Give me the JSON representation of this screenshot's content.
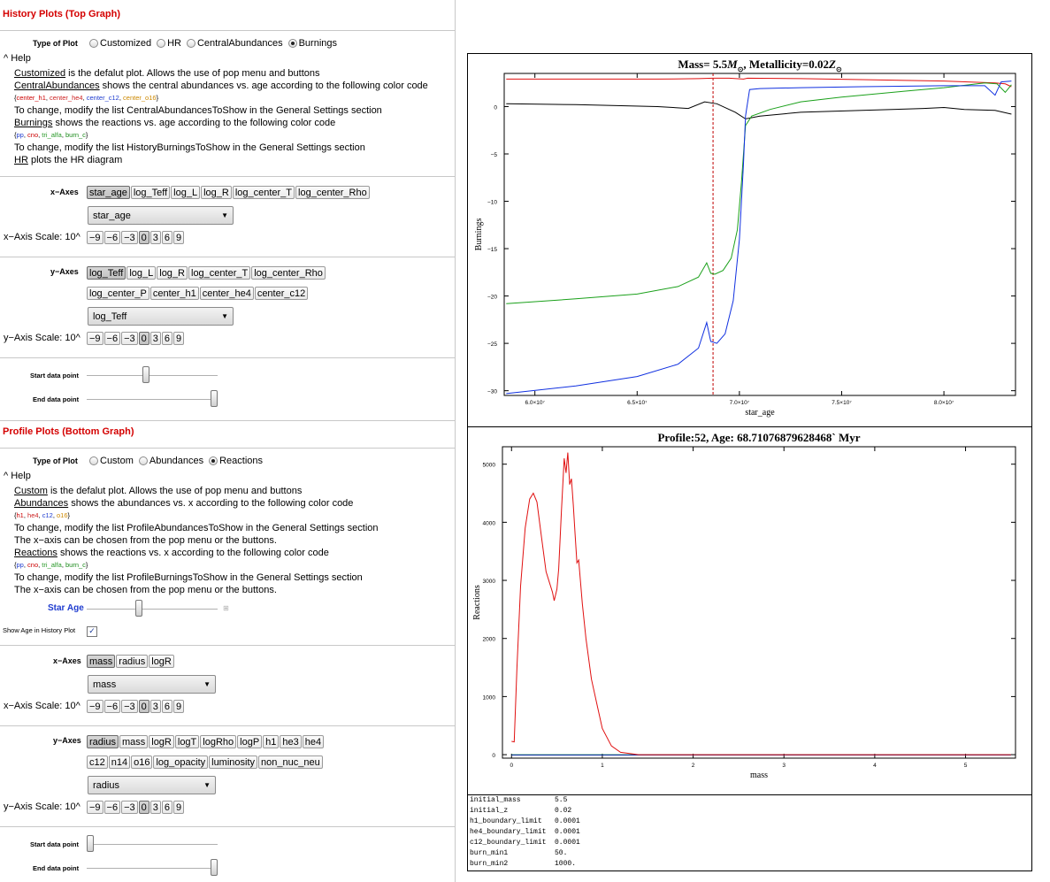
{
  "history": {
    "title": "History Plots (Top Graph)",
    "type_label": "Type of Plot",
    "type_options": [
      "Customized",
      "HR",
      "CentralAbundances",
      "Burnings"
    ],
    "type_selected_index": 3,
    "help_label": "Help",
    "help_lines": [
      {
        "u": "Customized",
        "rest": " is the defalut plot. Allows the use of pop menu and  buttons"
      },
      {
        "u": "CentralAbundances",
        "rest": " shows the central abundances vs. age according to the following color code"
      },
      {
        "u": "",
        "rest": "",
        "codes": [
          "center_h1",
          "center_he4",
          "center_c12",
          "center_o16"
        ]
      },
      {
        "u": "",
        "rest": "To change, modify the list CentralAbundancesToShow in the General Settings section"
      },
      {
        "u": "Burnings",
        "rest": " shows the reactions vs. age according to the following color code"
      },
      {
        "u": "",
        "rest": "",
        "codes": [
          "pp",
          "cno",
          "tri_alfa",
          "burn_c"
        ]
      },
      {
        "u": "",
        "rest": "To change, modify the list HistoryBurningsToShow in the General Settings section"
      },
      {
        "u": "HR",
        "rest": " plots the HR diagram"
      }
    ],
    "xaxes_label": "x−Axes",
    "xaxes_buttons": [
      "star_age",
      "log_Teff",
      "log_L",
      "log_R",
      "log_center_T",
      "log_center_Rho"
    ],
    "xaxes_selected": "star_age",
    "xscale_label": "x−Axis Scale: 10^",
    "scale_buttons": [
      "−9",
      "−6",
      "−3",
      "0",
      "3",
      "6",
      "9"
    ],
    "yaxes_label": "y−Axes",
    "yaxes_buttons_row1": [
      "log_Teff",
      "log_L",
      "log_R",
      "log_center_T",
      "log_center_Rho"
    ],
    "yaxes_buttons_row2": [
      "log_center_P",
      "center_h1",
      "center_he4",
      "center_c12"
    ],
    "yaxes_selected": "log_Teff",
    "yscale_label": "y−Axis Scale: 10^",
    "start_label": "Start data point",
    "end_label": "End data point",
    "start_value": 0.45,
    "end_value": 1.0
  },
  "profile": {
    "title": "Profile Plots (Bottom Graph)",
    "type_label": "Type of Plot",
    "type_options": [
      "Custom",
      "Abundances",
      "Reactions"
    ],
    "type_selected_index": 2,
    "help_label": "Help",
    "help_lines": [
      {
        "u": "Custom",
        "rest": " is the defalut plot. Allows the use of pop menu and  buttons"
      },
      {
        "u": "Abundances",
        "rest": " shows the abundances vs. x according to the following color code"
      },
      {
        "u": "",
        "rest": "",
        "codes": [
          "h1",
          "he4",
          "c12",
          "o16"
        ]
      },
      {
        "u": "",
        "rest": "To change, modify the list ProfileAbundancesToShow in the General Settings section"
      },
      {
        "u": "",
        "rest": "The x−axis can be chosen from the pop menu or the  buttons."
      },
      {
        "u": "Reactions",
        "rest": " shows the reactions vs. x according to the following color code"
      },
      {
        "u": "",
        "rest": "",
        "codes": [
          "pp",
          "cno",
          "tri_alfa",
          "burn_c"
        ]
      },
      {
        "u": "",
        "rest": "To change, modify the list ProfileBurningsToShow in the General Settings section"
      },
      {
        "u": "",
        "rest": "The x−axis can be chosen from the pop menu or the  buttons."
      }
    ],
    "star_age_label": "Star Age",
    "star_age_value": 0.39,
    "show_age_label": "Show Age in History Plot",
    "show_age_checked": true,
    "xaxes_label": "x−Axes",
    "xaxes_buttons": [
      "mass",
      "radius",
      "logR"
    ],
    "xaxes_selected": "mass",
    "xscale_label": "x−Axis Scale: 10^",
    "yaxes_label": "y−Axes",
    "yaxes_buttons_row1": [
      "radius",
      "mass",
      "logR",
      "logT",
      "logRho",
      "logP",
      "h1",
      "he3",
      "he4"
    ],
    "yaxes_buttons_row2": [
      "c12",
      "n14",
      "o16",
      "log_opacity",
      "luminosity",
      "non_nuc_neu"
    ],
    "yaxes_selected": "radius",
    "yscale_label": "y−Axis Scale: 10^",
    "start_label": "Start data point",
    "end_label": "End data point",
    "start_value": 0.0,
    "end_value": 1.0
  },
  "code_colors": [
    "#cc0000",
    "#cc2222",
    "#1f3ccf",
    "#cc8800"
  ],
  "burn_colors": [
    "#1f3ccf",
    "#cc0000",
    "#2a9a2a",
    "#1a8a1a"
  ],
  "chart_data": [
    {
      "type": "line",
      "title_parts": [
        "Mass= 5.5",
        "M",
        "⊙",
        ",  Metallicity=0.02",
        "Z",
        "⊙"
      ],
      "xlabel": "star_age",
      "ylabel": "Burnings",
      "xlim": [
        58500000,
        83500000
      ],
      "ylim": [
        -30.5,
        3.5
      ],
      "x_ticks": [
        60000000,
        65000000,
        70000000,
        75000000,
        80000000
      ],
      "x_tick_labels": [
        "6.0×10⁷",
        "6.5×10⁷",
        "7.0×10⁷",
        "7.5×10⁷",
        "8.0×10⁷"
      ],
      "y_ticks": [
        0,
        -5,
        -10,
        -15,
        -20,
        -25,
        -30
      ],
      "y_tick_labels": [
        "0",
        "−5",
        "−10",
        "−15",
        "−20",
        "−25",
        "−30"
      ],
      "marker_x": 68710768.8,
      "series": [
        {
          "color": "#e01010",
          "points": [
            [
              58600000,
              2.9
            ],
            [
              62000000,
              2.9
            ],
            [
              66000000,
              2.9
            ],
            [
              68000000,
              2.95
            ],
            [
              68700000,
              3.0
            ],
            [
              69500000,
              3.0
            ],
            [
              70200000,
              2.9
            ],
            [
              70400000,
              3.0
            ],
            [
              73000000,
              2.95
            ],
            [
              76000000,
              2.85
            ],
            [
              80000000,
              2.7
            ],
            [
              82500000,
              2.5
            ],
            [
              83000000,
              2.4
            ],
            [
              83300000,
              2.1
            ]
          ]
        },
        {
          "color": "#000000",
          "points": [
            [
              58600000,
              0.3
            ],
            [
              62000000,
              0.2
            ],
            [
              66000000,
              0.0
            ],
            [
              67500000,
              -0.2
            ],
            [
              68300000,
              0.5
            ],
            [
              68900000,
              0.3
            ],
            [
              69800000,
              -0.6
            ],
            [
              70300000,
              -1.3
            ],
            [
              71000000,
              -1.0
            ],
            [
              73000000,
              -0.6
            ],
            [
              76000000,
              -0.4
            ],
            [
              79000000,
              -0.2
            ],
            [
              80000000,
              -0.1
            ],
            [
              81000000,
              -0.3
            ],
            [
              82500000,
              -0.4
            ],
            [
              83300000,
              -0.8
            ]
          ]
        },
        {
          "color": "#1aa01a",
          "points": [
            [
              58600000,
              -20.8
            ],
            [
              62000000,
              -20.3
            ],
            [
              65000000,
              -19.8
            ],
            [
              67000000,
              -19.0
            ],
            [
              68000000,
              -18.0
            ],
            [
              68400000,
              -16.5
            ],
            [
              68600000,
              -17.6
            ],
            [
              68800000,
              -17.7
            ],
            [
              69200000,
              -17.3
            ],
            [
              69600000,
              -16.0
            ],
            [
              69900000,
              -13.0
            ],
            [
              70100000,
              -8.0
            ],
            [
              70300000,
              -2.0
            ],
            [
              70600000,
              -1.0
            ],
            [
              71500000,
              -0.3
            ],
            [
              73000000,
              0.5
            ],
            [
              75000000,
              1.0
            ],
            [
              78000000,
              1.6
            ],
            [
              80000000,
              2.0
            ],
            [
              82000000,
              2.5
            ],
            [
              82600000,
              2.4
            ],
            [
              83000000,
              1.5
            ],
            [
              83300000,
              2.3
            ]
          ]
        },
        {
          "color": "#1030e0",
          "points": [
            [
              58600000,
              -30.3
            ],
            [
              62000000,
              -29.5
            ],
            [
              65000000,
              -28.5
            ],
            [
              67000000,
              -27.2
            ],
            [
              68000000,
              -25.5
            ],
            [
              68400000,
              -22.8
            ],
            [
              68600000,
              -24.8
            ],
            [
              68900000,
              -25.0
            ],
            [
              69300000,
              -24.0
            ],
            [
              69700000,
              -20.5
            ],
            [
              70000000,
              -14.0
            ],
            [
              70200000,
              -6.0
            ],
            [
              70300000,
              -1.0
            ],
            [
              70500000,
              1.8
            ],
            [
              71000000,
              1.9
            ],
            [
              73000000,
              2.0
            ],
            [
              76000000,
              2.1
            ],
            [
              80000000,
              2.2
            ],
            [
              82000000,
              2.2
            ],
            [
              82500000,
              1.2
            ],
            [
              82800000,
              2.6
            ],
            [
              83300000,
              2.7
            ]
          ]
        }
      ]
    },
    {
      "type": "line",
      "title": "Profile:52, Age: 68.71076879628468` Myr",
      "xlabel": "mass",
      "ylabel": "Reactions",
      "xlim": [
        -0.1,
        5.55
      ],
      "ylim": [
        -60,
        5300
      ],
      "x_ticks": [
        0,
        1,
        2,
        3,
        4,
        5
      ],
      "x_tick_labels": [
        "0",
        "1",
        "2",
        "3",
        "4",
        "5"
      ],
      "y_ticks": [
        0,
        1000,
        2000,
        3000,
        4000,
        5000
      ],
      "y_tick_labels": [
        "0",
        "1000",
        "2000",
        "3000",
        "4000",
        "5000"
      ],
      "series": [
        {
          "color": "#1a8a5a",
          "points": [
            [
              0,
              0
            ],
            [
              5.5,
              0
            ]
          ]
        },
        {
          "color": "#1030a0",
          "points": [
            [
              0,
              -6
            ],
            [
              5.5,
              -6
            ]
          ]
        },
        {
          "color": "#e01010",
          "points": [
            [
              0.0,
              230
            ],
            [
              0.03,
              220
            ],
            [
              0.06,
              1500
            ],
            [
              0.1,
              2900
            ],
            [
              0.15,
              3900
            ],
            [
              0.2,
              4400
            ],
            [
              0.24,
              4500
            ],
            [
              0.28,
              4350
            ],
            [
              0.33,
              3750
            ],
            [
              0.38,
              3150
            ],
            [
              0.42,
              2950
            ],
            [
              0.45,
              2800
            ],
            [
              0.47,
              2650
            ],
            [
              0.5,
              2850
            ],
            [
              0.52,
              3200
            ],
            [
              0.55,
              4200
            ],
            [
              0.58,
              5100
            ],
            [
              0.6,
              4850
            ],
            [
              0.62,
              5200
            ],
            [
              0.64,
              4650
            ],
            [
              0.66,
              4750
            ],
            [
              0.68,
              4300
            ],
            [
              0.7,
              3800
            ],
            [
              0.72,
              3300
            ],
            [
              0.74,
              3350
            ],
            [
              0.78,
              2600
            ],
            [
              0.82,
              2000
            ],
            [
              0.88,
              1300
            ],
            [
              0.95,
              800
            ],
            [
              1.0,
              450
            ],
            [
              1.1,
              150
            ],
            [
              1.2,
              40
            ],
            [
              1.4,
              0
            ],
            [
              5.5,
              0
            ]
          ]
        }
      ]
    }
  ],
  "settings_table": [
    {
      "key": "initial_mass",
      "val": "5.5"
    },
    {
      "key": "initial_z",
      "val": "0.02"
    },
    {
      "key": "h1_boundary_limit",
      "val": "0.0001"
    },
    {
      "key": "he4_boundary_limit",
      "val": "0.0001"
    },
    {
      "key": "c12_boundary_limit",
      "val": "0.0001"
    },
    {
      "key": "burn_min1",
      "val": "50."
    },
    {
      "key": "burn_min2",
      "val": "1000."
    }
  ]
}
